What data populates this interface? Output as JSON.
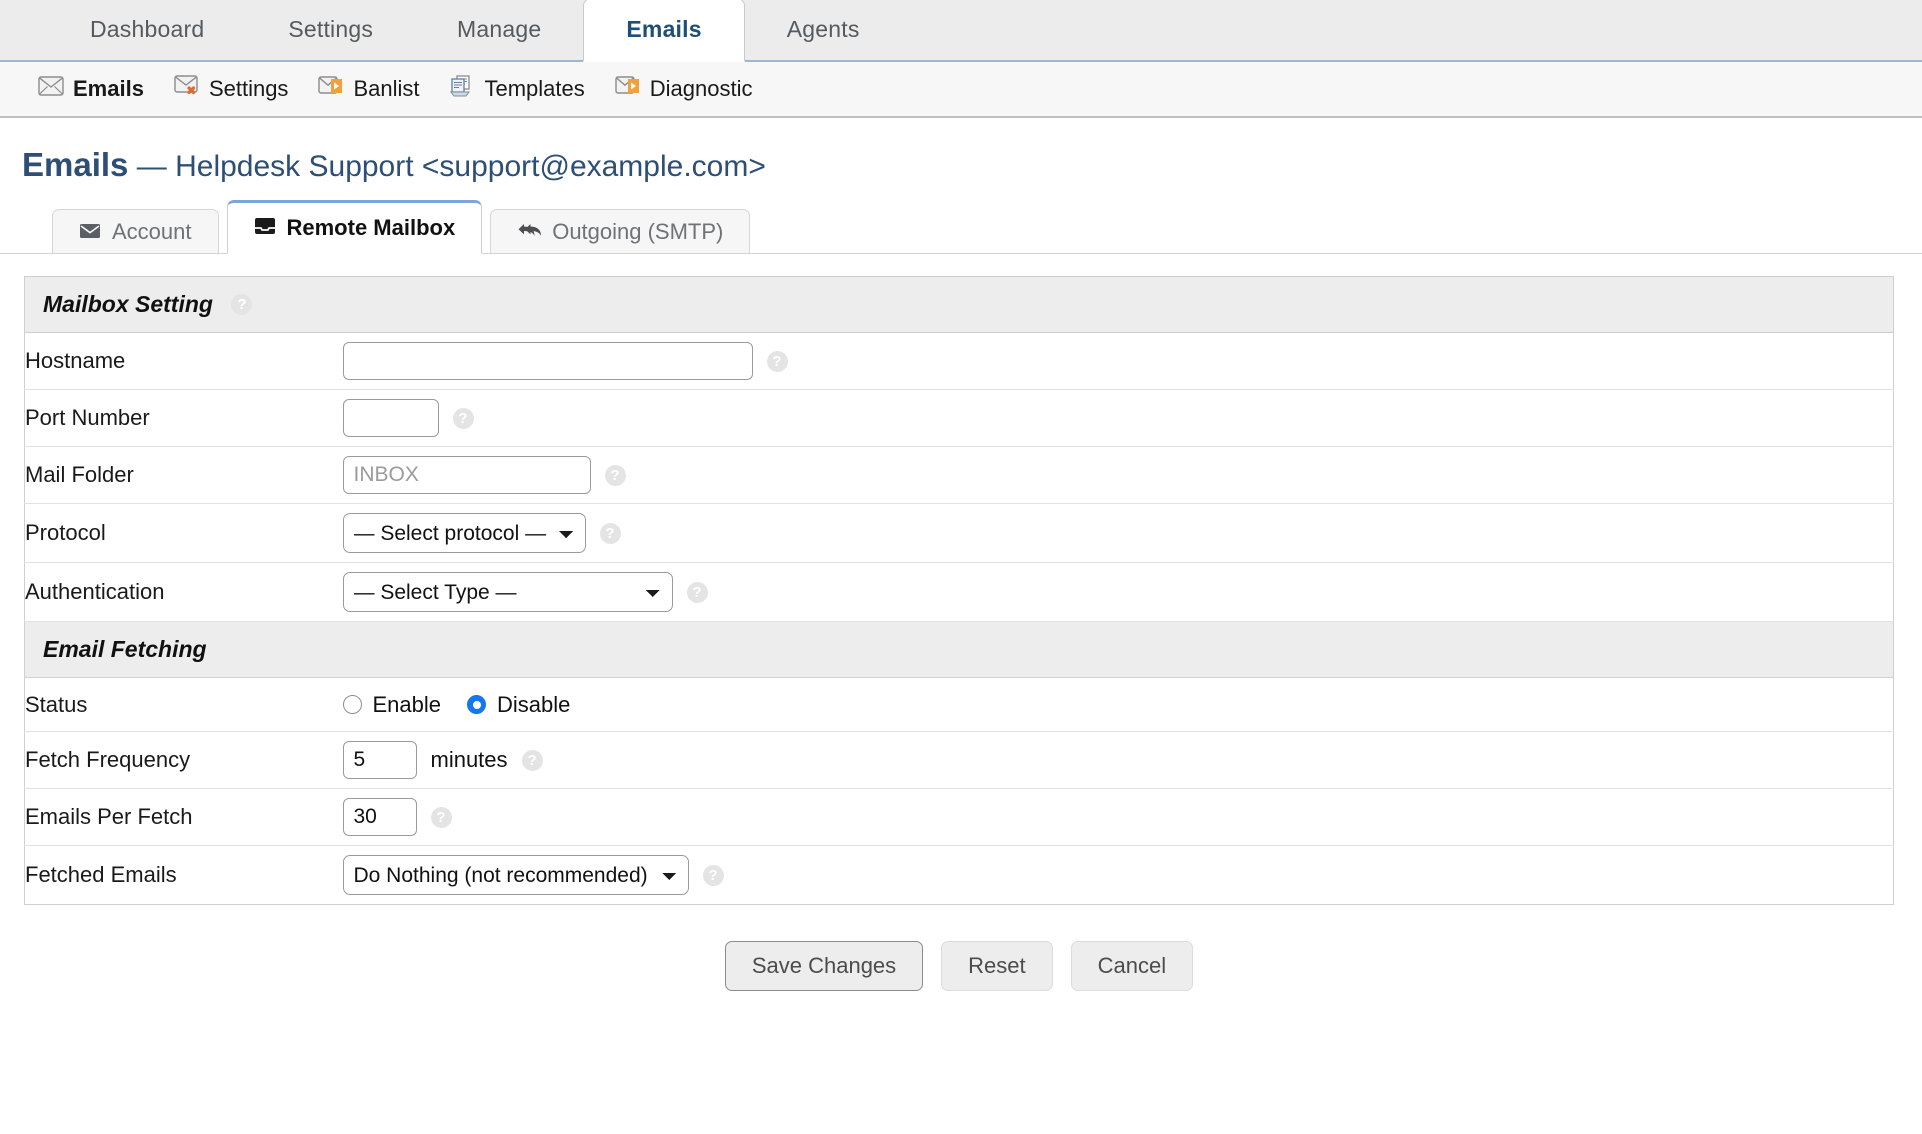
{
  "topnav": {
    "tabs": [
      {
        "label": "Dashboard",
        "active": false
      },
      {
        "label": "Settings",
        "active": false
      },
      {
        "label": "Manage",
        "active": false
      },
      {
        "label": "Emails",
        "active": true
      },
      {
        "label": "Agents",
        "active": false
      }
    ]
  },
  "subnav": {
    "items": [
      {
        "label": "Emails",
        "icon": "envelope-icon",
        "current": true
      },
      {
        "label": "Settings",
        "icon": "envelope-settings-icon",
        "current": false
      },
      {
        "label": "Banlist",
        "icon": "envelope-arrow-icon",
        "current": false
      },
      {
        "label": "Templates",
        "icon": "template-icon",
        "current": false
      },
      {
        "label": "Diagnostic",
        "icon": "envelope-arrow-icon",
        "current": false
      }
    ]
  },
  "page": {
    "title": "Emails",
    "separator": "—",
    "subtitle": "Helpdesk Support <support@example.com>"
  },
  "inner_tabs": [
    {
      "label": "Account",
      "icon": "envelope-icon",
      "active": false
    },
    {
      "label": "Remote Mailbox",
      "icon": "inbox-icon",
      "active": true
    },
    {
      "label": "Outgoing (SMTP)",
      "icon": "reply-all-icon",
      "active": false
    }
  ],
  "sections": {
    "mailbox": {
      "title": "Mailbox Setting",
      "has_help": true,
      "help_glyph": "?"
    },
    "fetching": {
      "title": "Email Fetching",
      "has_help": false
    }
  },
  "fields": {
    "hostname": {
      "label": "Hostname",
      "value": "",
      "placeholder": "",
      "help": "?"
    },
    "port": {
      "label": "Port Number",
      "value": "",
      "placeholder": "",
      "help": "?"
    },
    "mail_folder": {
      "label": "Mail Folder",
      "value": "",
      "placeholder": "INBOX",
      "help": "?"
    },
    "protocol": {
      "label": "Protocol",
      "selected": "— Select protocol —",
      "options": [
        "— Select protocol —"
      ],
      "help": "?"
    },
    "authentication": {
      "label": "Authentication",
      "selected": "— Select Type —",
      "options": [
        "— Select Type —"
      ],
      "help": "?"
    },
    "status": {
      "label": "Status",
      "options": [
        {
          "label": "Enable",
          "selected": false
        },
        {
          "label": "Disable",
          "selected": true
        }
      ]
    },
    "fetch_frequency": {
      "label": "Fetch Frequency",
      "value": "5",
      "unit": "minutes",
      "help": "?"
    },
    "emails_per_fetch": {
      "label": "Emails Per Fetch",
      "value": "30",
      "help": "?"
    },
    "fetched_emails": {
      "label": "Fetched Emails",
      "selected": "Do Nothing (not recommended)",
      "options": [
        "Do Nothing (not recommended)"
      ],
      "help": "?"
    }
  },
  "footer": {
    "save_label": "Save Changes",
    "reset_label": "Reset",
    "cancel_label": "Cancel"
  },
  "colors": {
    "accent_blue": "#1f4e79",
    "title_blue": "#2d4f75",
    "active_tab_border": "#7ba7d7",
    "radio_on": "#1577ee",
    "section_bg": "#ededed"
  }
}
